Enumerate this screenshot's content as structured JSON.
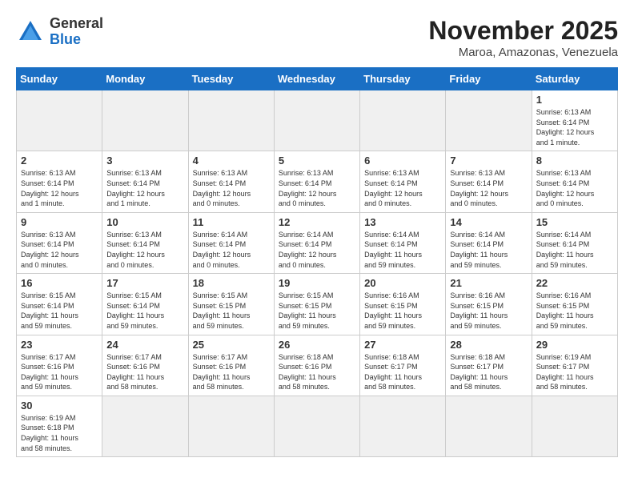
{
  "logo": {
    "general": "General",
    "blue": "Blue"
  },
  "header": {
    "month": "November 2025",
    "location": "Maroa, Amazonas, Venezuela"
  },
  "weekdays": [
    "Sunday",
    "Monday",
    "Tuesday",
    "Wednesday",
    "Thursday",
    "Friday",
    "Saturday"
  ],
  "weeks": [
    [
      {
        "day": "",
        "info": ""
      },
      {
        "day": "",
        "info": ""
      },
      {
        "day": "",
        "info": ""
      },
      {
        "day": "",
        "info": ""
      },
      {
        "day": "",
        "info": ""
      },
      {
        "day": "",
        "info": ""
      },
      {
        "day": "1",
        "info": "Sunrise: 6:13 AM\nSunset: 6:14 PM\nDaylight: 12 hours\nand 1 minute."
      }
    ],
    [
      {
        "day": "2",
        "info": "Sunrise: 6:13 AM\nSunset: 6:14 PM\nDaylight: 12 hours\nand 1 minute."
      },
      {
        "day": "3",
        "info": "Sunrise: 6:13 AM\nSunset: 6:14 PM\nDaylight: 12 hours\nand 1 minute."
      },
      {
        "day": "4",
        "info": "Sunrise: 6:13 AM\nSunset: 6:14 PM\nDaylight: 12 hours\nand 0 minutes."
      },
      {
        "day": "5",
        "info": "Sunrise: 6:13 AM\nSunset: 6:14 PM\nDaylight: 12 hours\nand 0 minutes."
      },
      {
        "day": "6",
        "info": "Sunrise: 6:13 AM\nSunset: 6:14 PM\nDaylight: 12 hours\nand 0 minutes."
      },
      {
        "day": "7",
        "info": "Sunrise: 6:13 AM\nSunset: 6:14 PM\nDaylight: 12 hours\nand 0 minutes."
      },
      {
        "day": "8",
        "info": "Sunrise: 6:13 AM\nSunset: 6:14 PM\nDaylight: 12 hours\nand 0 minutes."
      }
    ],
    [
      {
        "day": "9",
        "info": "Sunrise: 6:13 AM\nSunset: 6:14 PM\nDaylight: 12 hours\nand 0 minutes."
      },
      {
        "day": "10",
        "info": "Sunrise: 6:13 AM\nSunset: 6:14 PM\nDaylight: 12 hours\nand 0 minutes."
      },
      {
        "day": "11",
        "info": "Sunrise: 6:14 AM\nSunset: 6:14 PM\nDaylight: 12 hours\nand 0 minutes."
      },
      {
        "day": "12",
        "info": "Sunrise: 6:14 AM\nSunset: 6:14 PM\nDaylight: 12 hours\nand 0 minutes."
      },
      {
        "day": "13",
        "info": "Sunrise: 6:14 AM\nSunset: 6:14 PM\nDaylight: 11 hours\nand 59 minutes."
      },
      {
        "day": "14",
        "info": "Sunrise: 6:14 AM\nSunset: 6:14 PM\nDaylight: 11 hours\nand 59 minutes."
      },
      {
        "day": "15",
        "info": "Sunrise: 6:14 AM\nSunset: 6:14 PM\nDaylight: 11 hours\nand 59 minutes."
      }
    ],
    [
      {
        "day": "16",
        "info": "Sunrise: 6:15 AM\nSunset: 6:14 PM\nDaylight: 11 hours\nand 59 minutes."
      },
      {
        "day": "17",
        "info": "Sunrise: 6:15 AM\nSunset: 6:14 PM\nDaylight: 11 hours\nand 59 minutes."
      },
      {
        "day": "18",
        "info": "Sunrise: 6:15 AM\nSunset: 6:15 PM\nDaylight: 11 hours\nand 59 minutes."
      },
      {
        "day": "19",
        "info": "Sunrise: 6:15 AM\nSunset: 6:15 PM\nDaylight: 11 hours\nand 59 minutes."
      },
      {
        "day": "20",
        "info": "Sunrise: 6:16 AM\nSunset: 6:15 PM\nDaylight: 11 hours\nand 59 minutes."
      },
      {
        "day": "21",
        "info": "Sunrise: 6:16 AM\nSunset: 6:15 PM\nDaylight: 11 hours\nand 59 minutes."
      },
      {
        "day": "22",
        "info": "Sunrise: 6:16 AM\nSunset: 6:15 PM\nDaylight: 11 hours\nand 59 minutes."
      }
    ],
    [
      {
        "day": "23",
        "info": "Sunrise: 6:17 AM\nSunset: 6:16 PM\nDaylight: 11 hours\nand 59 minutes."
      },
      {
        "day": "24",
        "info": "Sunrise: 6:17 AM\nSunset: 6:16 PM\nDaylight: 11 hours\nand 58 minutes."
      },
      {
        "day": "25",
        "info": "Sunrise: 6:17 AM\nSunset: 6:16 PM\nDaylight: 11 hours\nand 58 minutes."
      },
      {
        "day": "26",
        "info": "Sunrise: 6:18 AM\nSunset: 6:16 PM\nDaylight: 11 hours\nand 58 minutes."
      },
      {
        "day": "27",
        "info": "Sunrise: 6:18 AM\nSunset: 6:17 PM\nDaylight: 11 hours\nand 58 minutes."
      },
      {
        "day": "28",
        "info": "Sunrise: 6:18 AM\nSunset: 6:17 PM\nDaylight: 11 hours\nand 58 minutes."
      },
      {
        "day": "29",
        "info": "Sunrise: 6:19 AM\nSunset: 6:17 PM\nDaylight: 11 hours\nand 58 minutes."
      }
    ],
    [
      {
        "day": "30",
        "info": "Sunrise: 6:19 AM\nSunset: 6:18 PM\nDaylight: 11 hours\nand 58 minutes."
      },
      {
        "day": "",
        "info": ""
      },
      {
        "day": "",
        "info": ""
      },
      {
        "day": "",
        "info": ""
      },
      {
        "day": "",
        "info": ""
      },
      {
        "day": "",
        "info": ""
      },
      {
        "day": "",
        "info": ""
      }
    ]
  ]
}
